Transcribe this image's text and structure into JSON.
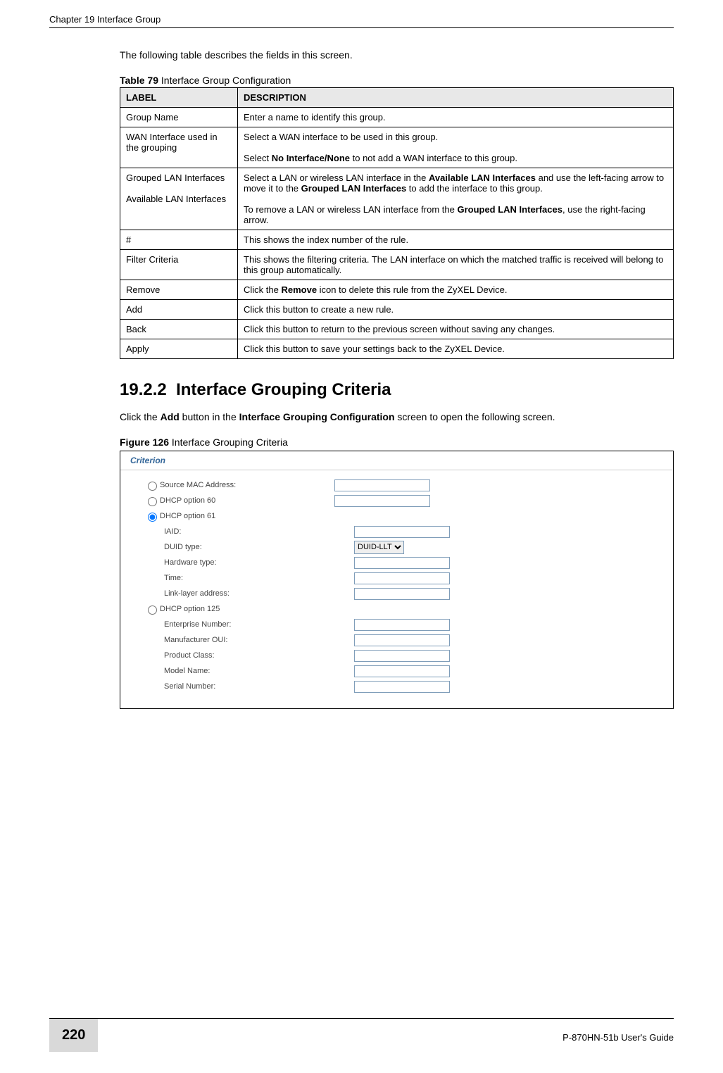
{
  "page": {
    "running_head": "Chapter 19 Interface Group",
    "number": "220",
    "guide": "P-870HN-51b User's Guide"
  },
  "intro_text": "The following table describes the fields in this screen.",
  "table79": {
    "caption_bold": "Table 79",
    "caption_rest": "   Interface Group Configuration",
    "header_label": "LABEL",
    "header_desc": "DESCRIPTION",
    "rows": [
      {
        "label": "Group Name",
        "desc_parts": [
          {
            "t": "Enter a name to identify this group."
          }
        ]
      },
      {
        "label": "WAN Interface used in the grouping",
        "desc_parts": [
          {
            "t": "Select a WAN interface to be used in this group."
          },
          {
            "br": true
          },
          {
            "t": "Select "
          },
          {
            "b": "No Interface/None"
          },
          {
            "t": " to not add a WAN interface to this group."
          }
        ]
      },
      {
        "label": "Grouped LAN Interfaces\n\nAvailable LAN Interfaces",
        "desc_parts": [
          {
            "t": "Select a LAN or wireless LAN interface in the "
          },
          {
            "b": "Available LAN Interfaces"
          },
          {
            "t": " and use the left-facing arrow to move it to the "
          },
          {
            "b": "Grouped LAN Interfaces"
          },
          {
            "t": " to add the interface to this group."
          },
          {
            "br": true
          },
          {
            "t": "To remove a LAN or wireless LAN interface from the "
          },
          {
            "b": "Grouped LAN Interfaces"
          },
          {
            "t": ", use the right-facing arrow."
          }
        ]
      },
      {
        "label": "#",
        "desc_parts": [
          {
            "t": "This shows the index number of the rule."
          }
        ]
      },
      {
        "label": "Filter Criteria",
        "desc_parts": [
          {
            "t": "This shows the filtering criteria. The LAN interface on which the matched traffic is received will belong to this group automatically."
          }
        ]
      },
      {
        "label": "Remove",
        "desc_parts": [
          {
            "t": "Click the "
          },
          {
            "b": "Remove"
          },
          {
            "t": " icon to delete this rule from the ZyXEL Device."
          }
        ]
      },
      {
        "label": "Add",
        "desc_parts": [
          {
            "t": "Click this button to create a new rule."
          }
        ]
      },
      {
        "label": "Back",
        "desc_parts": [
          {
            "t": "Click this button to return to the previous screen without saving any changes."
          }
        ]
      },
      {
        "label": "Apply",
        "desc_parts": [
          {
            "t": "Click this button to save your settings back to the ZyXEL Device."
          }
        ]
      }
    ]
  },
  "section": {
    "number": "19.2.2",
    "title": "Interface Grouping Criteria",
    "body_parts": [
      {
        "t": "Click the "
      },
      {
        "b": "Add"
      },
      {
        "t": " button in the "
      },
      {
        "b": "Interface Grouping Configuration"
      },
      {
        "t": " screen to open the following screen."
      }
    ]
  },
  "figure126": {
    "caption_bold": "Figure 126",
    "caption_rest": "   Interface Grouping Criteria",
    "panel_title": "Criterion",
    "radios": {
      "source_mac": "Source MAC Address:",
      "dhcp60": "DHCP option 60",
      "dhcp61": "DHCP option 61",
      "dhcp125": "DHCP option 125"
    },
    "dhcp61_fields": {
      "iaid": "IAID:",
      "duid_type": "DUID type:",
      "duid_select": "DUID-LLT",
      "hardware_type": "Hardware type:",
      "time": "Time:",
      "link_layer": "Link-layer address:"
    },
    "dhcp125_fields": {
      "enterprise": "Enterprise Number:",
      "manufacturer": "Manufacturer OUI:",
      "product_class": "Product Class:",
      "model_name": "Model Name:",
      "serial_number": "Serial Number:"
    }
  }
}
